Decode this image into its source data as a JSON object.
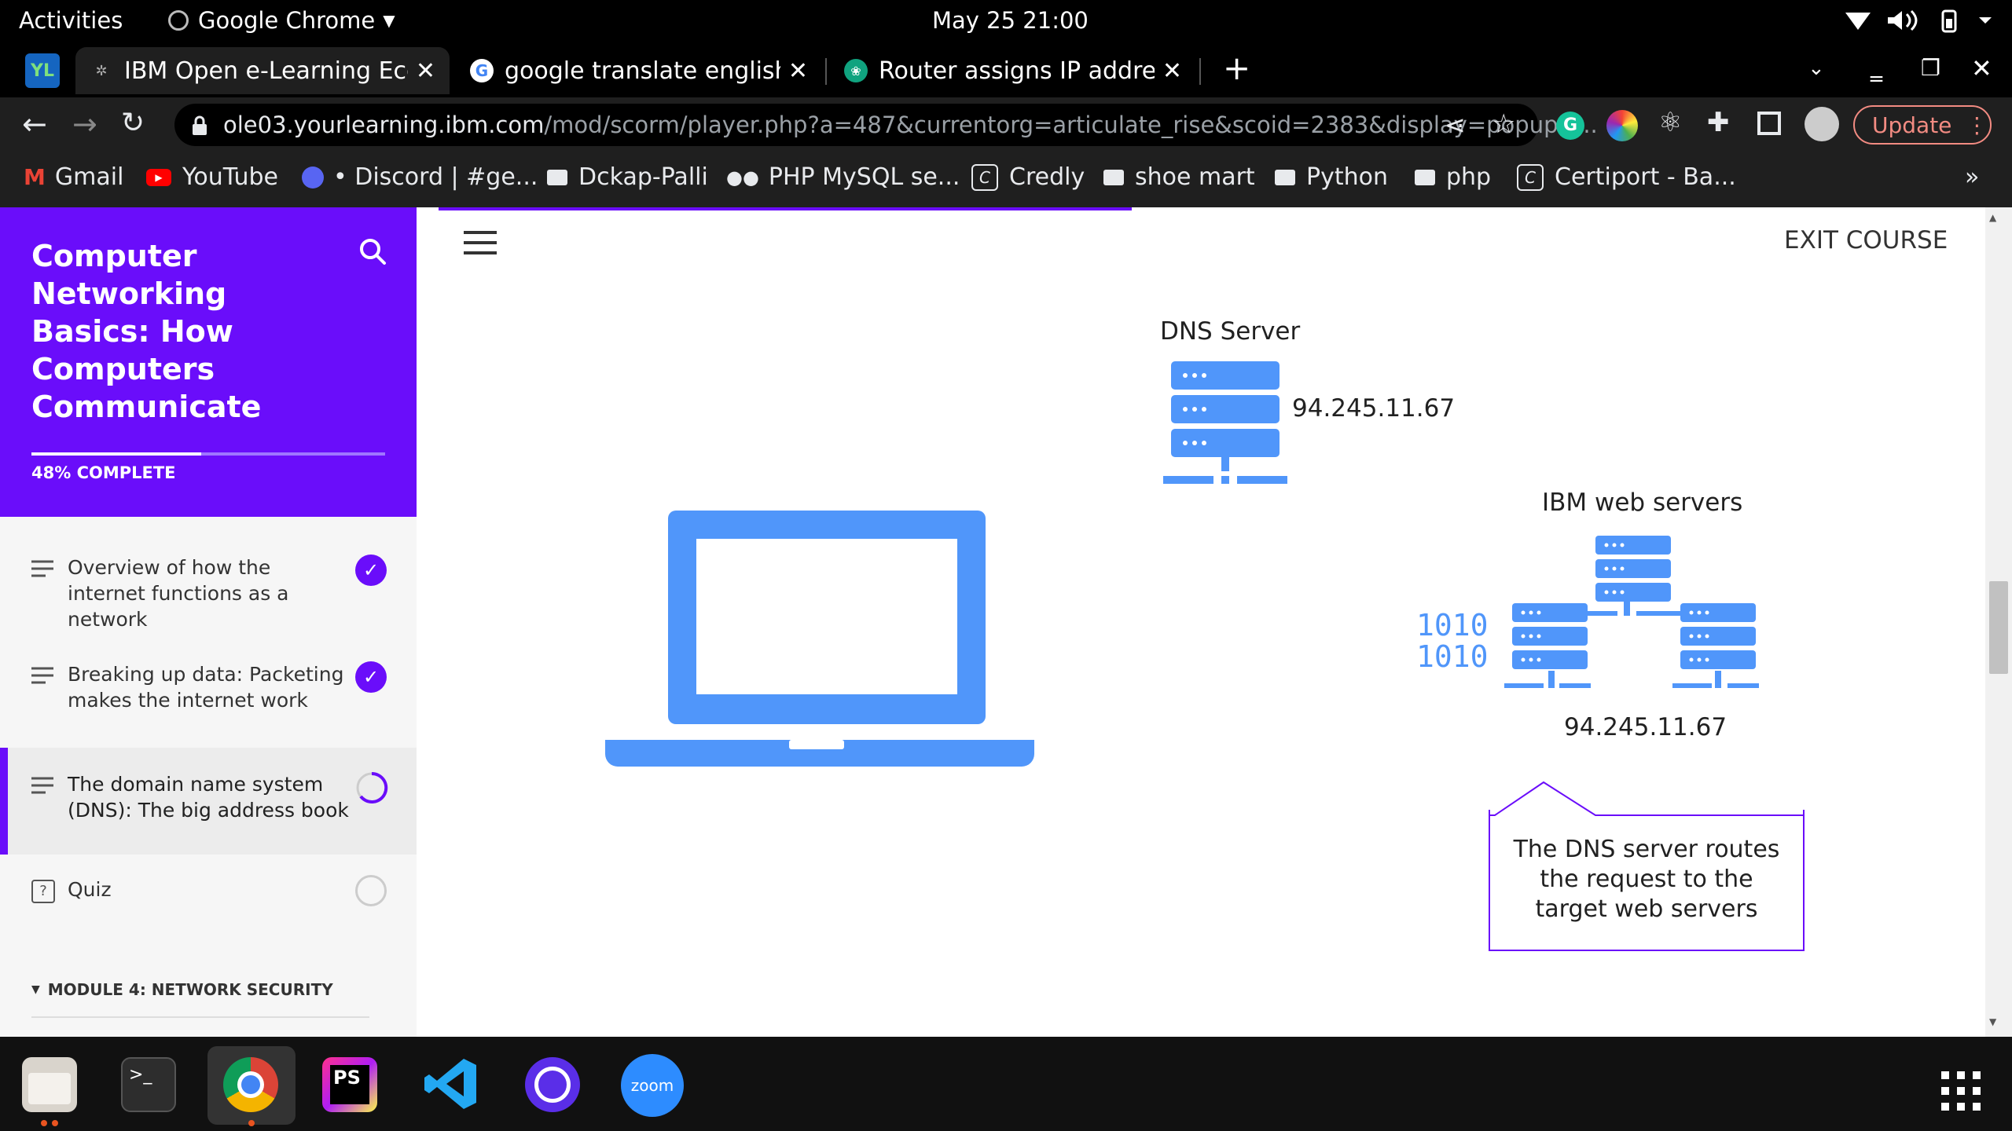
{
  "system_bar": {
    "activities": "Activities",
    "app_name": "Google Chrome",
    "clock": "May 25  21:00"
  },
  "tabs": [
    {
      "title": "IBM Open e-Learning Ecos",
      "active": true
    },
    {
      "title": "google translate english t",
      "active": false
    },
    {
      "title": "Router assigns IP address",
      "active": false
    }
  ],
  "new_tab": "+",
  "toolbar": {
    "url_host": "ole03.yourlearning.ibm.com",
    "url_path": "/mod/scorm/player.php?a=487&currentorg=articulate_rise&scoid=2383&display=popup&...",
    "update_label": "Update"
  },
  "bookmarks": [
    {
      "label": "Gmail",
      "icon": "gmail-icon"
    },
    {
      "label": "YouTube",
      "icon": "youtube-icon"
    },
    {
      "label": "• Discord | #ge...",
      "icon": "discord-icon"
    },
    {
      "label": "Dckap-Palli",
      "icon": "folder-icon"
    },
    {
      "label": "PHP MySQL se...",
      "icon": "medium-icon"
    },
    {
      "label": "Credly",
      "icon": "credly-icon"
    },
    {
      "label": "shoe mart",
      "icon": "folder-icon"
    },
    {
      "label": "Python",
      "icon": "folder-icon"
    },
    {
      "label": "php",
      "icon": "folder-icon"
    },
    {
      "label": "Certiport - Ba...",
      "icon": "certiport-icon"
    }
  ],
  "bookmarks_overflow": "»",
  "course": {
    "title": "Computer Networking Basics: How Computers Communicate",
    "progress_text": "48% COMPLETE",
    "progress_fraction": 0.48,
    "lessons": [
      {
        "label": "Overview of how the internet functions as a network",
        "status": "complete"
      },
      {
        "label": "Breaking up data: Packeting makes the internet work",
        "status": "complete"
      },
      {
        "label": "The domain name system (DNS): The big address book",
        "status": "in-progress"
      },
      {
        "label": "Quiz",
        "status": "not-started"
      }
    ],
    "module_heading": "MODULE 4: NETWORK SECURITY"
  },
  "lesson_view": {
    "exit_label": "EXIT COURSE",
    "dns_server_label": "DNS Server",
    "dns_ip": "94.245.11.67",
    "web_servers_label": "IBM web servers",
    "web_ip": "94.245.11.67",
    "binary_line1": "1010",
    "binary_line2": "1010",
    "callout": "The DNS server routes the request to the target web servers"
  },
  "dock_apps": [
    "files",
    "terminal",
    "google-chrome",
    "phpstorm",
    "vscode",
    "timeshift",
    "zoom"
  ],
  "zoom_label": "zoom",
  "ps_label": "PS",
  "colors": {
    "brand_purple": "#6a0dfa",
    "diagram_blue": "#5096fa",
    "text_dark": "#212121"
  }
}
